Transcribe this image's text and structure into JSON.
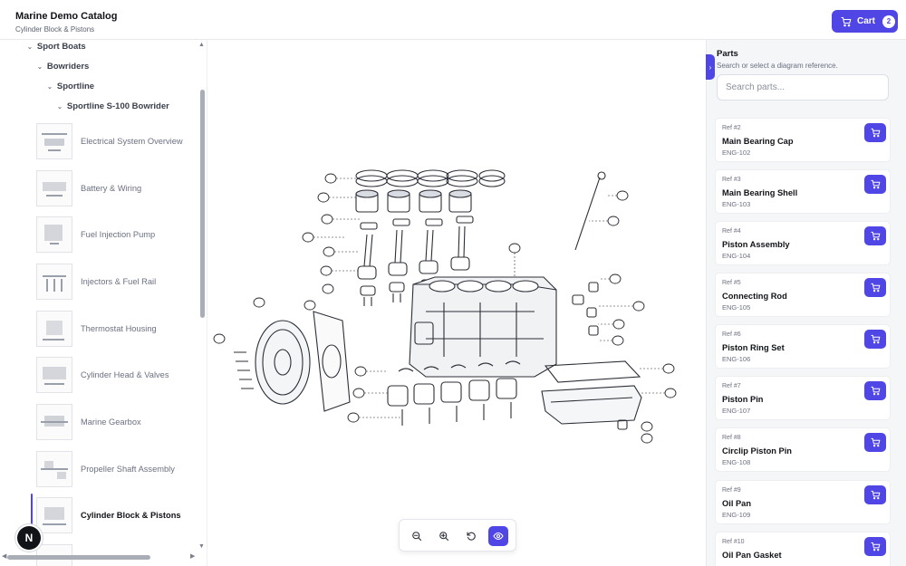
{
  "header": {
    "title": "Marine Demo Catalog",
    "subtitle": "Cylinder Block & Pistons",
    "cart_label": "Cart",
    "cart_count": "2"
  },
  "tree": {
    "level1": "Sport Boats",
    "level2": "Bowriders",
    "level3": "Sportline",
    "level4": "Sportline S-100 Bowrider"
  },
  "diagrams": [
    {
      "label": "Electrical System Overview"
    },
    {
      "label": "Battery & Wiring"
    },
    {
      "label": "Fuel Injection Pump"
    },
    {
      "label": "Injectors & Fuel Rail"
    },
    {
      "label": "Thermostat Housing"
    },
    {
      "label": "Cylinder Head & Valves"
    },
    {
      "label": "Marine Gearbox"
    },
    {
      "label": "Propeller Shaft Assembly"
    },
    {
      "label": "Cylinder Block & Pistons"
    }
  ],
  "badge": {
    "letter": "N"
  },
  "parts_panel": {
    "title": "Parts",
    "subtitle": "Search or select a diagram reference.",
    "search_placeholder": "Search parts...",
    "items": [
      {
        "ref": "Ref #2",
        "name": "Main Bearing Cap",
        "number": "ENG-102"
      },
      {
        "ref": "Ref #3",
        "name": "Main Bearing Shell",
        "number": "ENG-103"
      },
      {
        "ref": "Ref #4",
        "name": "Piston Assembly",
        "number": "ENG-104"
      },
      {
        "ref": "Ref #5",
        "name": "Connecting Rod",
        "number": "ENG-105"
      },
      {
        "ref": "Ref #6",
        "name": "Piston Ring Set",
        "number": "ENG-106"
      },
      {
        "ref": "Ref #7",
        "name": "Piston Pin",
        "number": "ENG-107"
      },
      {
        "ref": "Ref #8",
        "name": "Circlip Piston Pin",
        "number": "ENG-108"
      },
      {
        "ref": "Ref #9",
        "name": "Oil Pan",
        "number": "ENG-109"
      },
      {
        "ref": "Ref #10",
        "name": "Oil Pan Gasket",
        "number": ""
      }
    ]
  },
  "icons": {
    "cart": "cart-icon",
    "zoom_out": "zoom-out-icon",
    "zoom_in": "zoom-in-icon",
    "reset": "rotate-ccw-icon",
    "view": "eye-icon"
  },
  "colors": {
    "accent": "#5046e5",
    "panel_bg": "#f5f6f8"
  }
}
